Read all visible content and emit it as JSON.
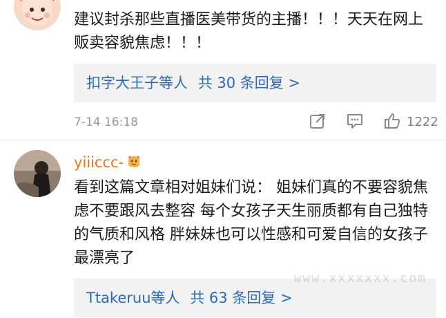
{
  "comments": [
    {
      "username": "",
      "text": "建议封杀那些直播医美带货的主播！！！天天在网上贩卖容貌焦虑！！！",
      "replies": {
        "user": "扣字大王子",
        "suffix": "等人",
        "count_label": "共 30 条回复 >"
      },
      "timestamp": "7-14 16:18",
      "likes": "1222"
    },
    {
      "username": "yiiiccc-",
      "badge_icon": "fan-badge-icon",
      "text": "看到这篇文章相对姐妹们说：  姐妹们真的不要容貌焦虑不要跟风去整容 每个女孩子天生丽质都有自己独特的气质和风格 胖妹妹也可以性感和可爱自信的女孩子最漂亮了",
      "replies": {
        "user": "Ttakeruu",
        "suffix": "等人",
        "count_label": "共 63 条回复 >"
      }
    }
  ],
  "watermark": "www.xxxxxxx.com",
  "colors": {
    "username": "#e8761c",
    "reply_link": "#2c6bb3",
    "reply_bg": "#f2f2f2",
    "meta_gray": "#9a9a9a"
  }
}
